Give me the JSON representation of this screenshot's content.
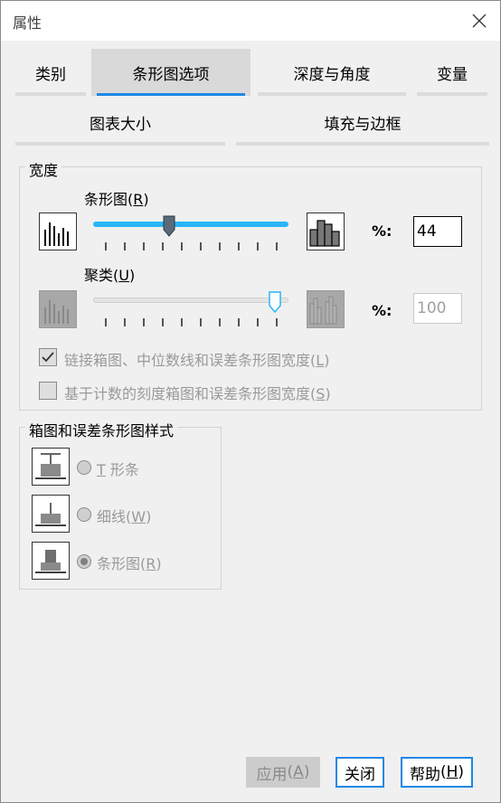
{
  "window": {
    "title": "属性"
  },
  "tabs": {
    "category": "类别",
    "bar_options": "条形图选项",
    "depth_angle": "深度与角度",
    "variables": "变量",
    "chart_size": "图表大小",
    "fill_border": "填充与边框"
  },
  "width_group": {
    "legend": "宽度",
    "bar": {
      "label": "条形图",
      "mnemonic": "R",
      "pct_label": "%:",
      "value": "44"
    },
    "cluster": {
      "label": "聚类",
      "mnemonic": "U",
      "pct_label": "%:",
      "value": "100"
    },
    "link_checkbox": {
      "label": "链接箱图、中位数线和误差条形图宽度",
      "mnemonic": "L",
      "checked": true
    },
    "count_checkbox": {
      "label": "基于计数的刻度箱图和误差条形图宽度",
      "mnemonic": "S",
      "checked": false
    }
  },
  "style_group": {
    "legend": "箱图和误差条形图样式",
    "t_bar": {
      "prefix": "T",
      "label": " 形条"
    },
    "thin_line": {
      "label": "细线",
      "mnemonic": "W"
    },
    "bar": {
      "label": "条形图",
      "mnemonic": "R",
      "selected": true
    }
  },
  "buttons": {
    "apply": {
      "label": "应用",
      "mnemonic": "A"
    },
    "close": "关闭",
    "help": {
      "label": "帮助",
      "mnemonic": "H"
    }
  },
  "colors": {
    "accent": "#1e88e5",
    "slider_blue": "#29b6f6"
  }
}
